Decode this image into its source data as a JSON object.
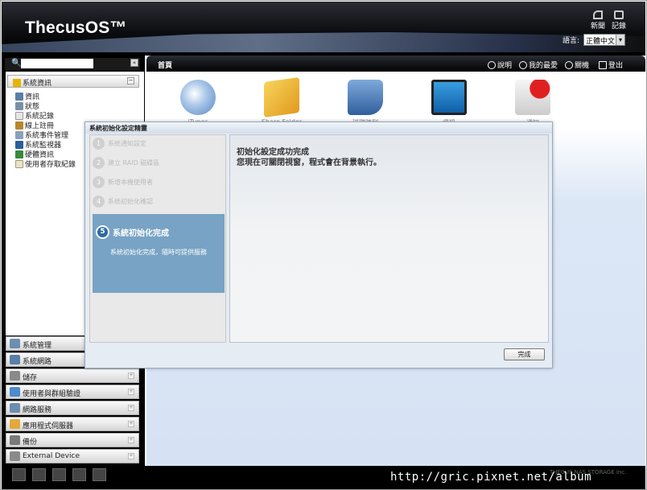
{
  "header": {
    "logo": "ThecusOS™",
    "news": "新聞",
    "log": "記錄",
    "lang_label": "語言:",
    "lang_value": "正體中文"
  },
  "search": {
    "placeholder": ""
  },
  "tree": {
    "section": "系統資訊",
    "items": [
      "資訊",
      "狀態",
      "系統記錄",
      "線上註冊",
      "系統事件管理",
      "系統監視器",
      "硬體資訊",
      "使用者存取紀錄"
    ]
  },
  "menu": [
    "系統管理",
    "系統網路",
    "儲存",
    "使用者與群組驗證",
    "網路服務",
    "應用程式伺服器",
    "備份",
    "External Device"
  ],
  "mainbar": {
    "home": "首頁",
    "help": "說明",
    "fav": "我的最愛",
    "shutdown": "關機",
    "logout": "登出"
  },
  "apps": [
    "iTunes",
    "Share Folder",
    "磁碟陣列",
    "資訊",
    "通知"
  ],
  "dialog": {
    "title": "系統初始化設定精靈",
    "steps": [
      "系統通知設定",
      "建立 RAID 磁碟區",
      "新增本機使用者",
      "系統初始化確認"
    ],
    "active_num": "5",
    "active_title": "系統初始化完成",
    "active_desc": "系統初始化完成，隨時可提供服務",
    "msg1": "初始化設定成功完成",
    "msg2": "您現在可關閉視窗，程式會在背景執行。",
    "finish": "完成"
  },
  "footer": {
    "watermark": "http://gric.pixnet.net/album",
    "small": "THECUS NAS STORAGE inc."
  }
}
